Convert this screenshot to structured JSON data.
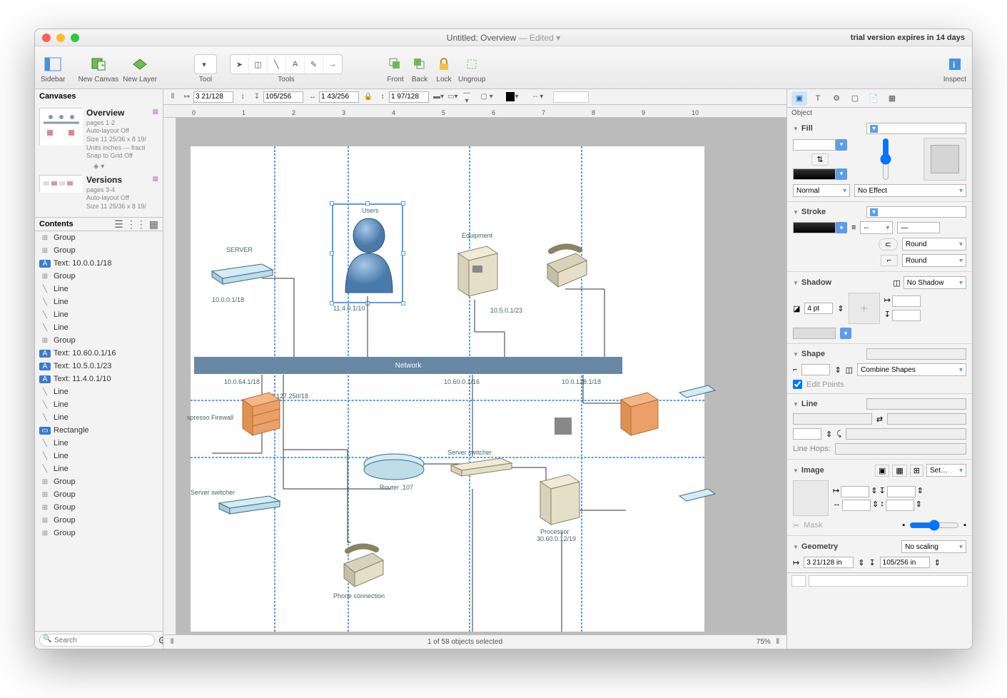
{
  "title": {
    "doc": "Untitled: Overview",
    "state": "— Edited ▾"
  },
  "trial_text": "trial version expires in 14 days",
  "toolbar": {
    "sidebar": "Sidebar",
    "new_canvas": "New Canvas",
    "new_layer": "New Layer",
    "tool": "Tool",
    "tools": "Tools",
    "front": "Front",
    "back": "Back",
    "lock": "Lock",
    "ungroup": "Ungroup",
    "inspect": "Inspect"
  },
  "geom": {
    "x": "3 21/128",
    "y": "105/256",
    "w": "1 43/256",
    "h": "1 97/128"
  },
  "sidebar": {
    "header": "Canvases",
    "canvases": [
      {
        "name": "Overview",
        "pages": "pages 1-2",
        "meta": [
          "Auto-layout Off",
          "Size 11 25/36 x 8 19/",
          "Units inches — fracti",
          "Snap to Grid Off"
        ]
      },
      {
        "name": "Versions",
        "pages": "pages 3-4",
        "meta": [
          "Auto-layout Off",
          "Size 11 25/36 x 8 19/"
        ]
      }
    ],
    "contents_header": "Contents",
    "items": [
      {
        "icon": "grp",
        "label": "Group"
      },
      {
        "icon": "grp",
        "label": "Group"
      },
      {
        "icon": "txt",
        "label": "Text: 10.0.0.1/18"
      },
      {
        "icon": "grp",
        "label": "Group"
      },
      {
        "icon": "lin",
        "label": "Line"
      },
      {
        "icon": "lin",
        "label": "Line"
      },
      {
        "icon": "lin",
        "label": "Line"
      },
      {
        "icon": "lin",
        "label": "Line"
      },
      {
        "icon": "grp",
        "label": "Group"
      },
      {
        "icon": "txt",
        "label": "Text: 10.60.0.1/16"
      },
      {
        "icon": "txt",
        "label": "Text: 10.5.0.1/23"
      },
      {
        "icon": "txt",
        "label": "Text: 11.4.0.1/10"
      },
      {
        "icon": "lin",
        "label": "Line"
      },
      {
        "icon": "lin",
        "label": "Line"
      },
      {
        "icon": "lin",
        "label": "Line"
      },
      {
        "icon": "rct",
        "label": "Rectangle"
      },
      {
        "icon": "lin",
        "label": "Line"
      },
      {
        "icon": "lin",
        "label": "Line"
      },
      {
        "icon": "lin",
        "label": "Line"
      },
      {
        "icon": "grp",
        "label": "Group"
      },
      {
        "icon": "grp",
        "label": "Group"
      },
      {
        "icon": "grp",
        "label": "Group"
      },
      {
        "icon": "grp",
        "label": "Group"
      },
      {
        "icon": "grp",
        "label": "Group"
      }
    ],
    "search_ph": "Search"
  },
  "canvas_labels": {
    "server": "SERVER",
    "users": "Users",
    "equipment": "Equipment",
    "ip1": "10.0.0.1/18",
    "ip2": "11.4.0.1/10",
    "ip3": "10.5.0.1/23",
    "network": "Network",
    "ip4": "10.0.64.1/18",
    "ip5": "10.60.0.1/16",
    "ip6": "10.0.128.1/18",
    "ip7": "10.0.127.250/18",
    "fw": "spresso Firewall",
    "switcher": "Server switcher",
    "switcher2": "Server switcher",
    "router": "Router .107",
    "processor": "Processor",
    "proc_ip": "30.60.0.12/19",
    "phone": "Phone connection"
  },
  "status": {
    "text": "1 of 58 objects selected",
    "zoom": "75%"
  },
  "inspector": {
    "tab": "Object",
    "fill_h": "Fill",
    "blend": "Normal",
    "effect": "No Effect",
    "stroke_h": "Stroke",
    "cap": "Round",
    "join": "Round",
    "dash": "--",
    "shadow_h": "Shadow",
    "shadow_sel": "No Shadow",
    "shadow_pt": "4 pt",
    "shape_h": "Shape",
    "combine": "Combine Shapes",
    "edit_pts": "Edit Points",
    "line_h": "Line",
    "hops": "Line Hops:",
    "image_h": "Image",
    "img_set": "Set…",
    "mask": "Mask",
    "geom_h": "Geometry",
    "scaling": "No scaling",
    "gx": "3 21/128 in",
    "gy": "105/256 in"
  }
}
